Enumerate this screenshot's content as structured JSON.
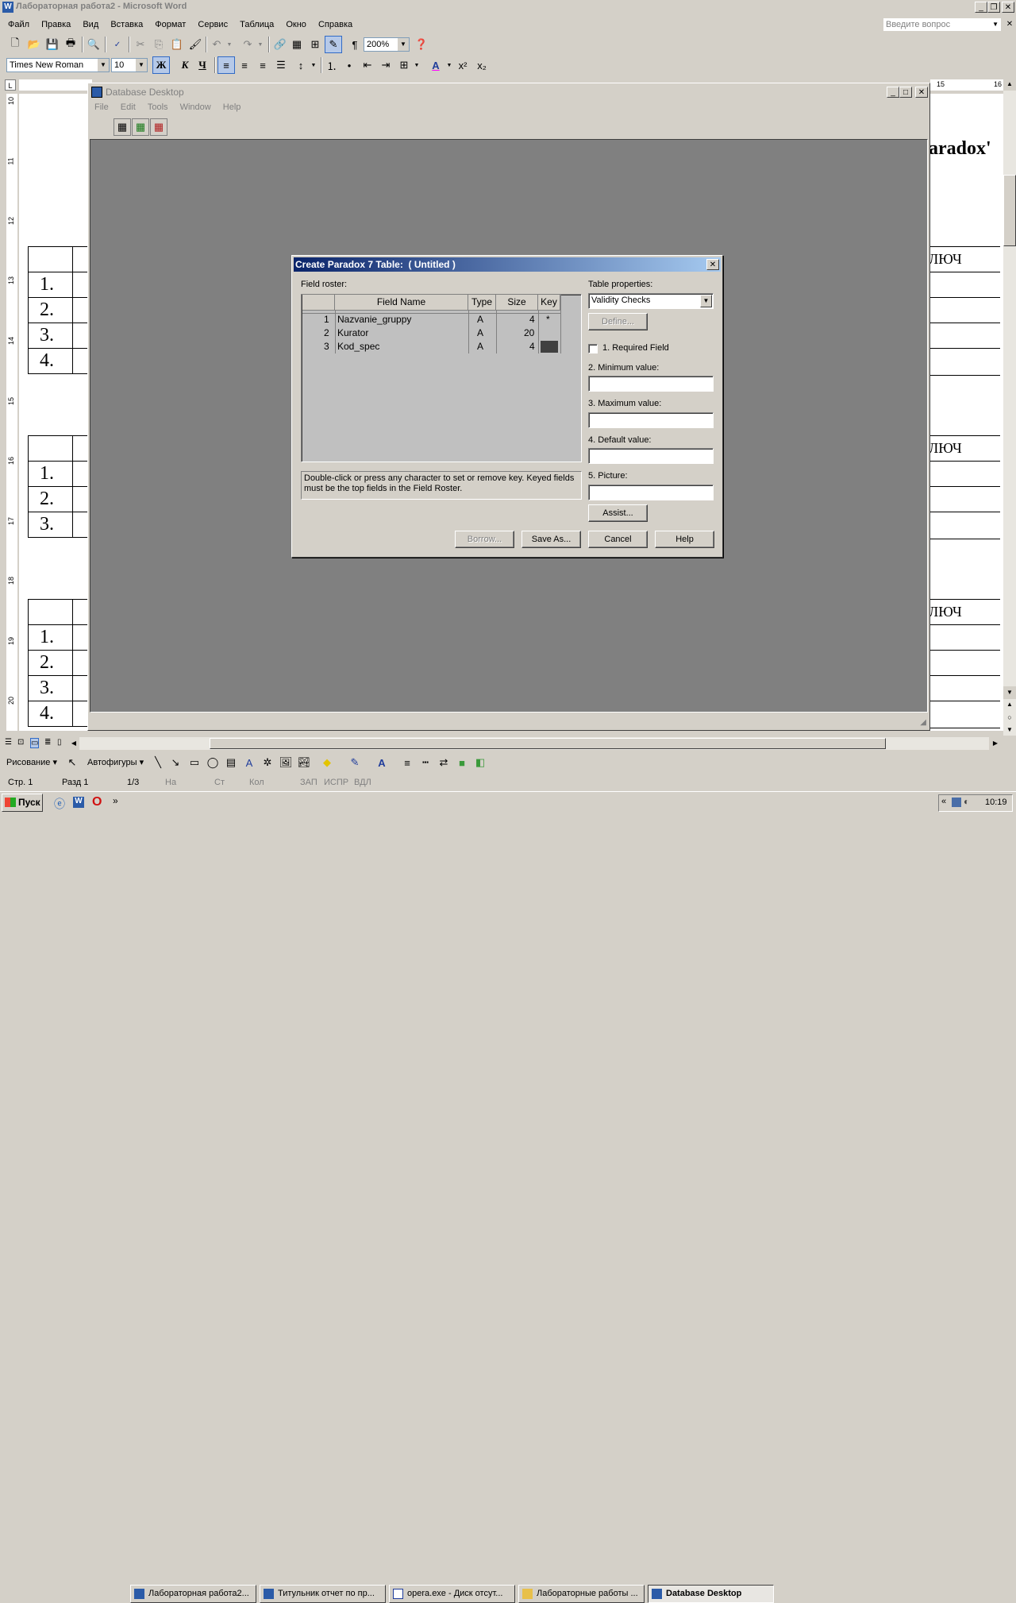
{
  "word": {
    "title": "Лабораторная работа2 - Microsoft Word",
    "menu": [
      "Файл",
      "Правка",
      "Вид",
      "Вставка",
      "Формат",
      "Сервис",
      "Таблица",
      "Окно",
      "Справка"
    ],
    "ask_placeholder": "Введите вопрос",
    "zoom": "200%",
    "font_name": "Times New Roman",
    "font_size": "10",
    "bold_label": "Ж",
    "italic_label": "К",
    "underline_label": "Ч",
    "right_ruler": [
      "15",
      "16"
    ],
    "vertical_ruler": [
      "10",
      "11",
      "12",
      "13",
      "14",
      "15",
      "16",
      "17",
      "18",
      "19",
      "20"
    ],
    "doc_right_texts": [
      "aradox'",
      "ЛЮЧ",
      "ЛЮЧ",
      "ЛЮЧ"
    ],
    "table_rows_1": [
      "1.",
      "2.",
      "3.",
      "4."
    ],
    "table_rows_2": [
      "1.",
      "2.",
      "3."
    ],
    "table_rows_3": [
      "1.",
      "2.",
      "3.",
      "4."
    ],
    "drawing_label": "Рисование",
    "autoshapes_label": "Автофигуры",
    "status": {
      "page": "Стр. 1",
      "section": "Разд 1",
      "pages": "1/3",
      "at": "На",
      "line": "Ст",
      "col": "Кол",
      "rec": "ЗАП",
      "trk": "ИСПР",
      "ext": "ВДЛ"
    }
  },
  "dbd": {
    "title": "Database Desktop",
    "menu": [
      "File",
      "Edit",
      "Tools",
      "Window",
      "Help"
    ]
  },
  "dialog": {
    "title": "Create Paradox 7 Table:  ( Untitled )",
    "field_roster_label": "Field roster:",
    "columns": [
      "",
      "Field Name",
      "Type",
      "Size",
      "Key"
    ],
    "fields": [
      {
        "num": "1",
        "name": "Nazvanie_gruppy",
        "type": "A",
        "size": "4",
        "key": "*"
      },
      {
        "num": "2",
        "name": "Kurator",
        "type": "A",
        "size": "20",
        "key": ""
      },
      {
        "num": "3",
        "name": "Kod_spec",
        "type": "A",
        "size": "4",
        "key": ""
      }
    ],
    "hint": "Double-click or press any character to set or remove key. Keyed fields must be the top fields in the Field Roster.",
    "table_properties_label": "Table properties:",
    "table_properties_value": "Validity Checks",
    "define_button": "Define...",
    "required_field": "1. Required Field",
    "minimum_label": "2. Minimum value:",
    "maximum_label": "3. Maximum value:",
    "default_label": "4. Default value:",
    "picture_label": "5. Picture:",
    "assist_button": "Assist...",
    "borrow_button": "Borrow...",
    "save_as_button": "Save As...",
    "cancel_button": "Cancel",
    "help_button": "Help"
  },
  "taskbar": {
    "start": "Пуск",
    "items": [
      "Лабораторная работа2...",
      "Титульник отчет по пр...",
      "opera.exe - Диск отсут...",
      "Лабораторные работы ...",
      "Database Desktop"
    ],
    "clock": "10:19"
  }
}
